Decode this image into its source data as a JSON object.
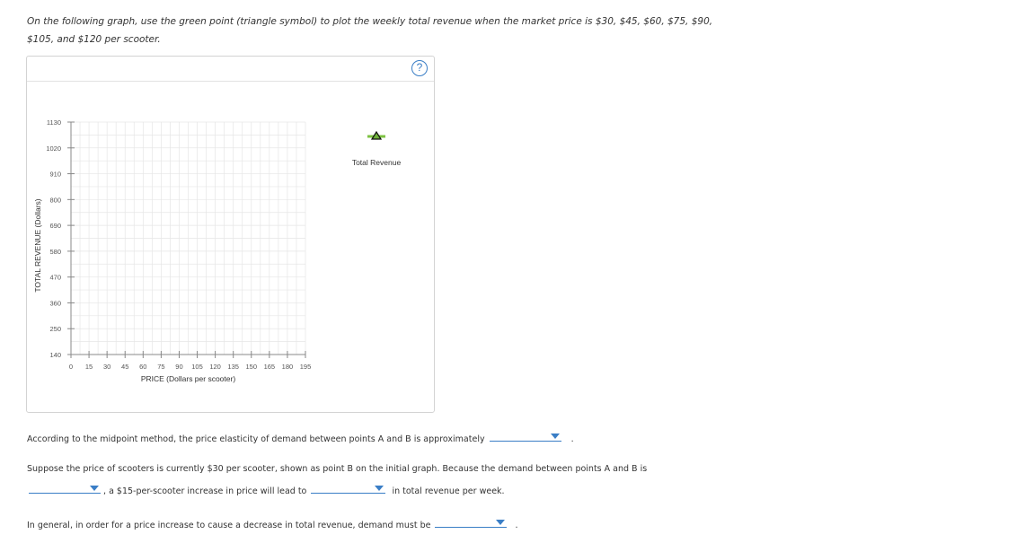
{
  "instructions": {
    "line1": "On the following graph, use the green point (triangle symbol) to plot the weekly total revenue when the market price is $30, $45, $60, $75, $90,",
    "line2": "$105, and $120 per scooter."
  },
  "graph": {
    "help_label": "?",
    "legend_label": "Total Revenue",
    "colors": {
      "legend_line": "#7dc242",
      "legend_marker_fill": "#6fb03a",
      "grid": "#e6e6e6",
      "axis": "#888888",
      "help": "#3a7ec6"
    }
  },
  "chart_data": {
    "type": "scatter",
    "xlabel": "PRICE (Dollars per scooter)",
    "ylabel": "TOTAL REVENUE (Dollars)",
    "x_ticks": [
      0,
      15,
      30,
      45,
      60,
      75,
      90,
      105,
      120,
      135,
      150,
      165,
      180,
      195
    ],
    "y_ticks": [
      140,
      250,
      360,
      470,
      580,
      690,
      800,
      910,
      1020,
      1130
    ],
    "xlim": [
      0,
      195
    ],
    "ylim": [
      140,
      1130
    ],
    "grid": true,
    "series": [
      {
        "name": "Total Revenue",
        "marker": "triangle",
        "points": []
      }
    ]
  },
  "questions": {
    "q1": {
      "text": "According to the midpoint method, the price elasticity of demand between points A and B is approximately",
      "value": "",
      "end": "."
    },
    "q2": {
      "text_a": "Suppose the price of scooters is currently $30 per scooter, shown as point B on the initial graph. Because the demand between points A and B is",
      "select1_value": "",
      "text_b": ", a $15-per-scooter increase in price will lead to",
      "select2_value": "",
      "text_c": "in total revenue per week."
    },
    "q3": {
      "text": "In general, in order for a price increase to cause a decrease in total revenue, demand must be",
      "value": "",
      "end": "."
    }
  }
}
